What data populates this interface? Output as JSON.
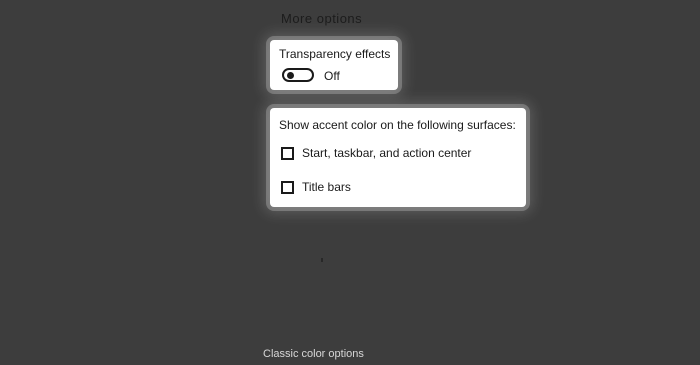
{
  "section": {
    "heading": "More options"
  },
  "transparency": {
    "label": "Transparency effects",
    "toggle_state_label": "Off",
    "toggle_on": false
  },
  "accent_surfaces": {
    "label": "Show accent color on the following surfaces:",
    "options": [
      {
        "label": "Start, taskbar, and action center",
        "checked": false
      },
      {
        "label": "Title bars",
        "checked": false
      }
    ]
  },
  "footer": {
    "link_label": "Classic color options"
  },
  "colors": {
    "background": "#3d3d3d",
    "card": "#ffffff",
    "text": "#1a1a1a"
  }
}
